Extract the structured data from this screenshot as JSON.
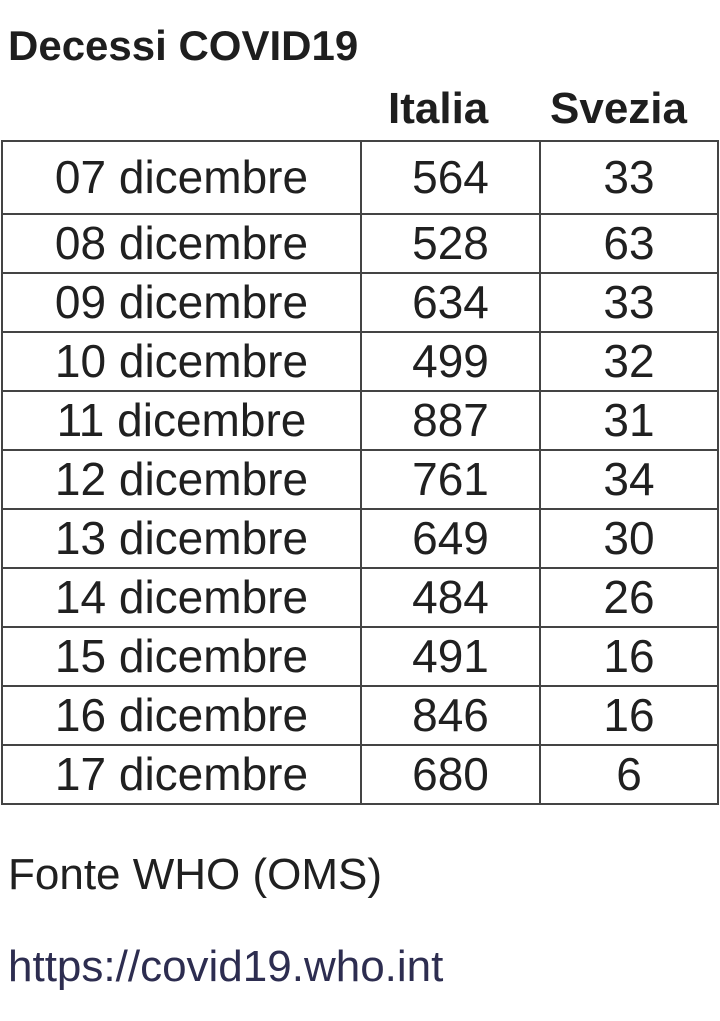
{
  "title": "Decessi COVID19",
  "columns": {
    "italia": "Italia",
    "svezia": "Svezia"
  },
  "rows": [
    {
      "date": "07 dicembre",
      "italia": "564",
      "svezia": "33"
    },
    {
      "date": "08 dicembre",
      "italia": "528",
      "svezia": "63"
    },
    {
      "date": "09 dicembre",
      "italia": "634",
      "svezia": "33"
    },
    {
      "date": "10 dicembre",
      "italia": "499",
      "svezia": "32"
    },
    {
      "date": "11 dicembre",
      "italia": "887",
      "svezia": "31"
    },
    {
      "date": "12 dicembre",
      "italia": "761",
      "svezia": "34"
    },
    {
      "date": "13 dicembre",
      "italia": "649",
      "svezia": "30"
    },
    {
      "date": "14 dicembre",
      "italia": "484",
      "svezia": "26"
    },
    {
      "date": "15 dicembre",
      "italia": "491",
      "svezia": "16"
    },
    {
      "date": "16 dicembre",
      "italia": "846",
      "svezia": "16"
    },
    {
      "date": "17 dicembre",
      "italia": "680",
      "svezia": "6"
    }
  ],
  "source": "Fonte WHO (OMS)",
  "link": "https://covid19.who.int"
}
